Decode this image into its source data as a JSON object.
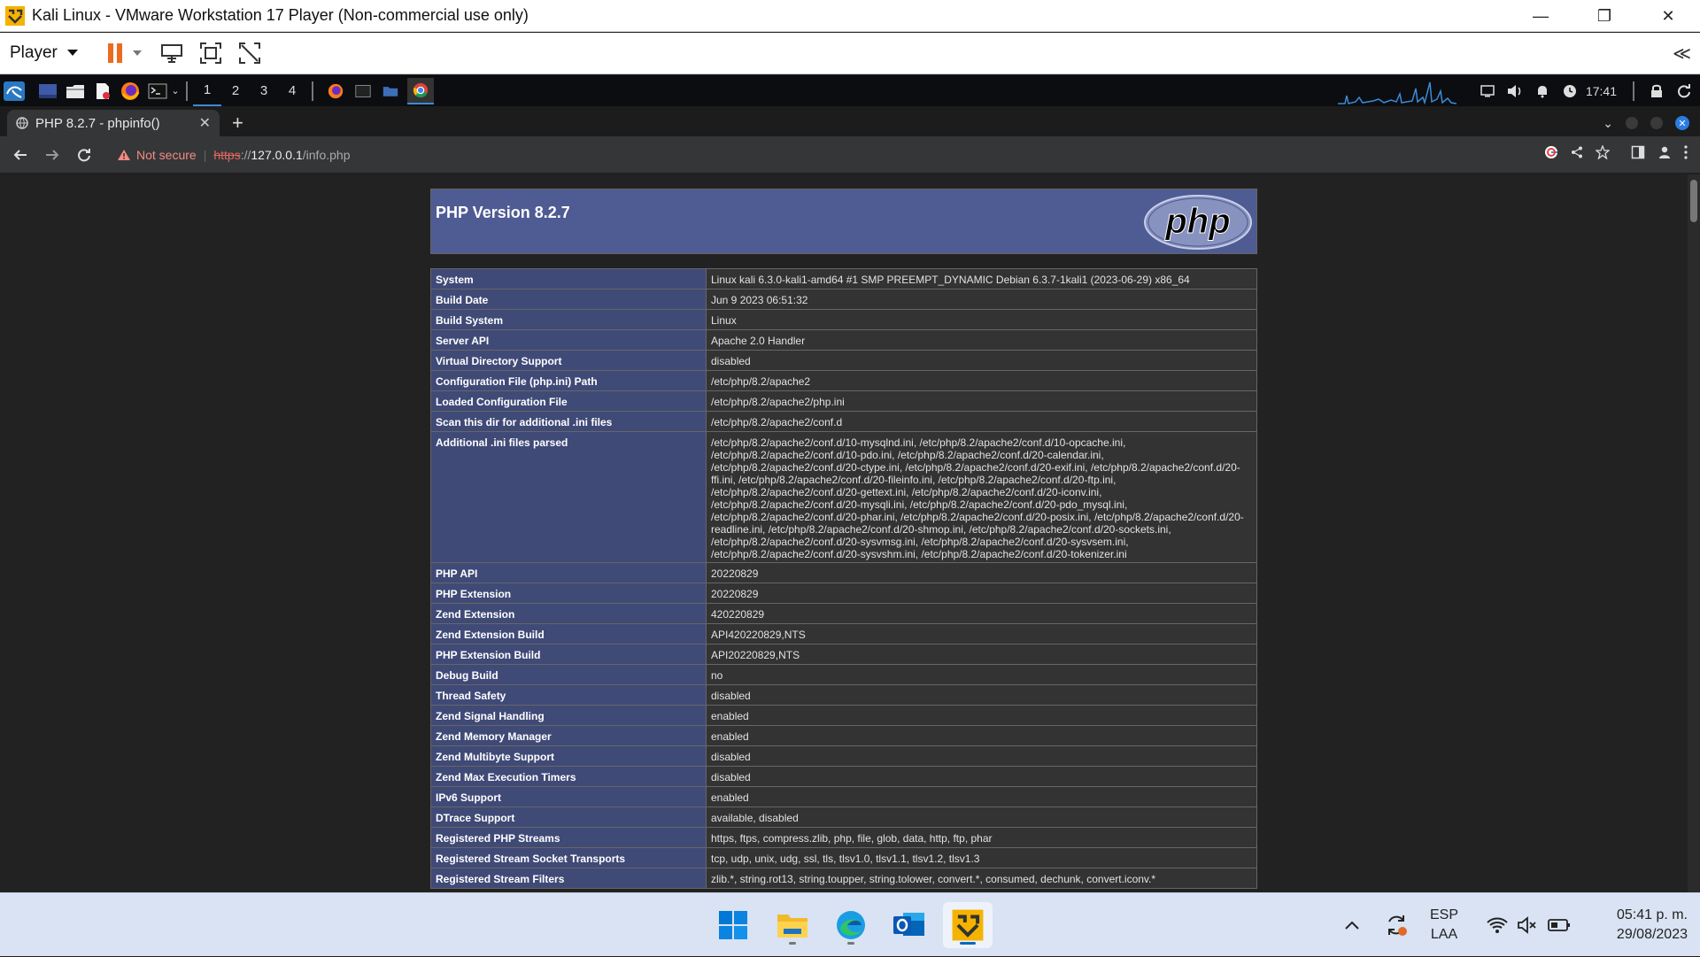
{
  "window": {
    "title": "Kali Linux - VMware Workstation 17 Player (Non-commercial use only)",
    "minimize": "—",
    "maximize": "❐",
    "close": "✕"
  },
  "vmtoolbar": {
    "player_label": "Player",
    "collapse": "≪"
  },
  "kali_panel": {
    "workspaces": [
      "1",
      "2",
      "3",
      "4"
    ],
    "active_workspace": "1",
    "time": "17:41"
  },
  "browser": {
    "tab_title": "PHP 8.2.7 - phpinfo()",
    "new_tab": "+",
    "security_label": "Not secure",
    "url_scheme": "https",
    "url_sep": "://",
    "url_host": "127.0.0.1",
    "url_path": "/info.php"
  },
  "phpinfo": {
    "version_title": "PHP Version 8.2.7",
    "logo_text": "php",
    "rows": [
      {
        "k": "System",
        "v": "Linux kali 6.3.0-kali1-amd64 #1 SMP PREEMPT_DYNAMIC Debian 6.3.7-1kali1 (2023-06-29) x86_64"
      },
      {
        "k": "Build Date",
        "v": "Jun 9 2023 06:51:32"
      },
      {
        "k": "Build System",
        "v": "Linux"
      },
      {
        "k": "Server API",
        "v": "Apache 2.0 Handler"
      },
      {
        "k": "Virtual Directory Support",
        "v": "disabled"
      },
      {
        "k": "Configuration File (php.ini) Path",
        "v": "/etc/php/8.2/apache2"
      },
      {
        "k": "Loaded Configuration File",
        "v": "/etc/php/8.2/apache2/php.ini"
      },
      {
        "k": "Scan this dir for additional .ini files",
        "v": "/etc/php/8.2/apache2/conf.d"
      },
      {
        "k": "Additional .ini files parsed",
        "v": "/etc/php/8.2/apache2/conf.d/10-mysqlnd.ini, /etc/php/8.2/apache2/conf.d/10-opcache.ini,\n/etc/php/8.2/apache2/conf.d/10-pdo.ini, /etc/php/8.2/apache2/conf.d/20-calendar.ini,\n/etc/php/8.2/apache2/conf.d/20-ctype.ini, /etc/php/8.2/apache2/conf.d/20-exif.ini, /etc/php/8.2/apache2/conf.d/20-\nffi.ini, /etc/php/8.2/apache2/conf.d/20-fileinfo.ini, /etc/php/8.2/apache2/conf.d/20-ftp.ini,\n/etc/php/8.2/apache2/conf.d/20-gettext.ini, /etc/php/8.2/apache2/conf.d/20-iconv.ini,\n/etc/php/8.2/apache2/conf.d/20-mysqli.ini, /etc/php/8.2/apache2/conf.d/20-pdo_mysql.ini,\n/etc/php/8.2/apache2/conf.d/20-phar.ini, /etc/php/8.2/apache2/conf.d/20-posix.ini, /etc/php/8.2/apache2/conf.d/20-\nreadline.ini, /etc/php/8.2/apache2/conf.d/20-shmop.ini, /etc/php/8.2/apache2/conf.d/20-sockets.ini,\n/etc/php/8.2/apache2/conf.d/20-sysvmsg.ini, /etc/php/8.2/apache2/conf.d/20-sysvsem.ini,\n/etc/php/8.2/apache2/conf.d/20-sysvshm.ini, /etc/php/8.2/apache2/conf.d/20-tokenizer.ini"
      },
      {
        "k": "PHP API",
        "v": "20220829"
      },
      {
        "k": "PHP Extension",
        "v": "20220829"
      },
      {
        "k": "Zend Extension",
        "v": "420220829"
      },
      {
        "k": "Zend Extension Build",
        "v": "API420220829,NTS"
      },
      {
        "k": "PHP Extension Build",
        "v": "API20220829,NTS"
      },
      {
        "k": "Debug Build",
        "v": "no"
      },
      {
        "k": "Thread Safety",
        "v": "disabled"
      },
      {
        "k": "Zend Signal Handling",
        "v": "enabled"
      },
      {
        "k": "Zend Memory Manager",
        "v": "enabled"
      },
      {
        "k": "Zend Multibyte Support",
        "v": "disabled"
      },
      {
        "k": "Zend Max Execution Timers",
        "v": "disabled"
      },
      {
        "k": "IPv6 Support",
        "v": "enabled"
      },
      {
        "k": "DTrace Support",
        "v": "available, disabled"
      },
      {
        "k": "Registered PHP Streams",
        "v": "https, ftps, compress.zlib, php, file, glob, data, http, ftp, phar"
      },
      {
        "k": "Registered Stream Socket Transports",
        "v": "tcp, udp, unix, udg, ssl, tls, tlsv1.0, tlsv1.1, tlsv1.2, tlsv1.3"
      },
      {
        "k": "Registered Stream Filters",
        "v": "zlib.*, string.rot13, string.toupper, string.tolower, convert.*, consumed, dechunk, convert.iconv.*"
      }
    ]
  },
  "taskbar": {
    "lang_line1": "ESP",
    "lang_line2": "LAA",
    "time": "05:41 p. m.",
    "date": "29/08/2023"
  },
  "colors": {
    "php_header": "#4F5B93",
    "php_key": "#404A77",
    "php_value": "#333333",
    "taskbar": "#d9e3f3",
    "accent_blue": "#0a67c2"
  }
}
